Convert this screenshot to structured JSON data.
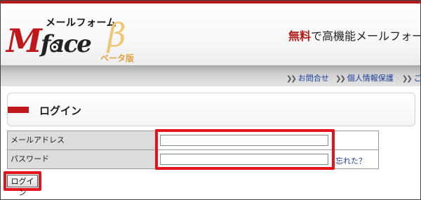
{
  "header": {
    "logo": {
      "kana": "メールフォーム",
      "main_cap": "M",
      "main_rest": "face",
      "beta_glyph": "β",
      "beta_label": "ベータ版"
    },
    "tagline_highlight": "無料",
    "tagline_rest": "で高機能メールフォー"
  },
  "nav": {
    "items": [
      {
        "label": "お問合せ"
      },
      {
        "label": "個人情報保護"
      },
      {
        "label": "ご"
      }
    ]
  },
  "login_panel": {
    "title": "ログイン"
  },
  "form": {
    "email_label": "メールアドレス",
    "email_value": "",
    "password_label": "パスワード",
    "password_value": "",
    "forgot_label": "忘れた？",
    "submit_label": "ログイン"
  },
  "colors": {
    "brand_red": "#c0161c",
    "highlight_red": "#e4141c",
    "link_blue": "#1c3f9a"
  }
}
